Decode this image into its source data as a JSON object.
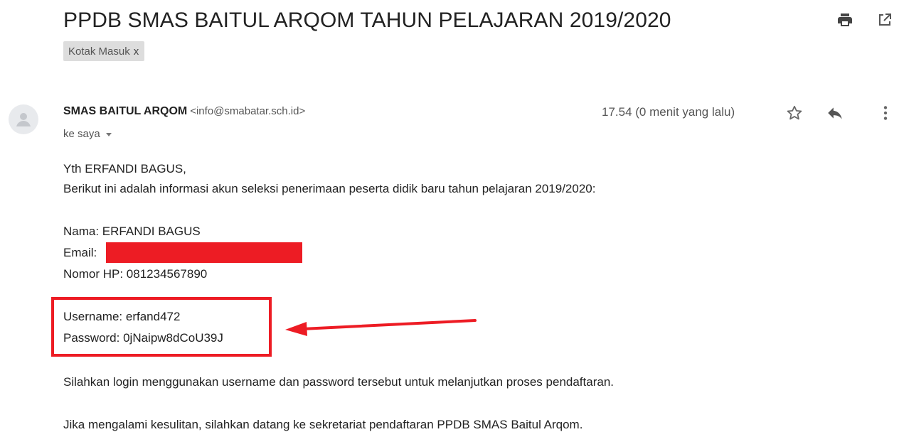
{
  "email": {
    "subject": "PPDB SMAS BAITUL ARQOM TAHUN PELAJARAN 2019/2020",
    "label": "Kotak Masuk",
    "label_remove": "x",
    "sender_name": "SMAS BAITUL ARQOM",
    "sender_email": "<info@smabatar.sch.id>",
    "recipient": "ke saya",
    "time": "17.54 (0 menit yang lalu)",
    "body": {
      "greeting": "Yth ERFANDI BAGUS,",
      "intro": "Berikut ini adalah informasi akun seleksi penerimaan peserta didik baru tahun pelajaran 2019/2020:",
      "nama": "Nama: ERFANDI BAGUS",
      "email_label": "Email:",
      "nomor_hp": "Nomor HP: 081234567890",
      "username": "Username: erfand472",
      "password": "Password: 0jNaipw8dCoU39J",
      "instruction": "Silahkan login menggunakan username dan password tersebut untuk melanjutkan proses pendaftaran.",
      "help": "Jika mengalami kesulitan, silahkan datang ke sekretariat pendaftaran PPDB SMAS Baitul Arqom."
    }
  },
  "icons": {
    "print": "print-icon",
    "open_new_window": "open-in-new-window-icon",
    "avatar": "default-avatar-icon",
    "star": "star-icon",
    "reply": "reply-icon",
    "more": "more-vertical-icon",
    "dropdown": "chevron-down-icon"
  },
  "colors": {
    "annotation_red": "#ed1c24",
    "label_chip_bg": "#dddddd",
    "avatar_bg": "#e8eaed"
  }
}
